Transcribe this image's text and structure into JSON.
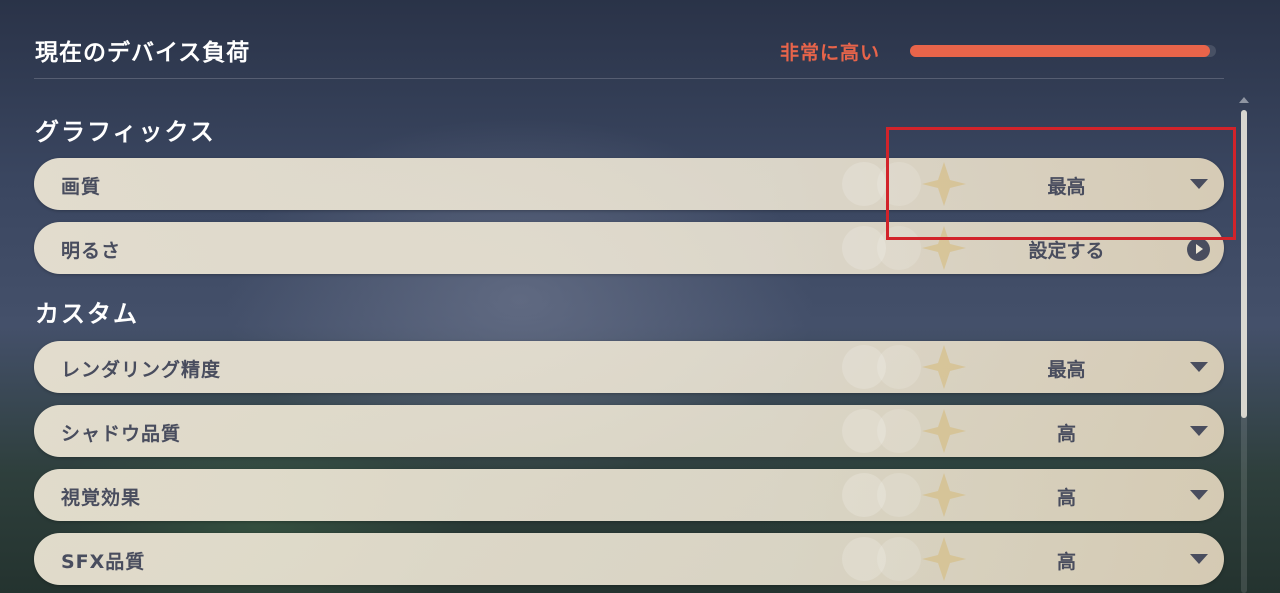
{
  "header": {
    "title": "現在のデバイス負荷",
    "load_status": "非常に高い",
    "load_level_fraction": 0.98,
    "load_color": "#e8644a"
  },
  "sections": {
    "graphics": {
      "title": "グラフィックス",
      "quality": {
        "label": "画質",
        "value": "最高"
      },
      "brightness": {
        "label": "明るさ",
        "value": "設定する"
      }
    },
    "custom": {
      "title": "カスタム",
      "render_resolution": {
        "label": "レンダリング精度",
        "value": "最高"
      },
      "shadow_quality": {
        "label": "シャドウ品質",
        "value": "高"
      },
      "visual_effects": {
        "label": "視覚効果",
        "value": "高"
      },
      "sfx_quality": {
        "label": "SFX品質",
        "value": "高"
      }
    }
  },
  "icons": {
    "dropdown": "chevron-down-icon",
    "go": "arrow-right-circle-icon"
  },
  "colors": {
    "row_text": "#494d5e",
    "highlight_box": "#d2232a"
  }
}
